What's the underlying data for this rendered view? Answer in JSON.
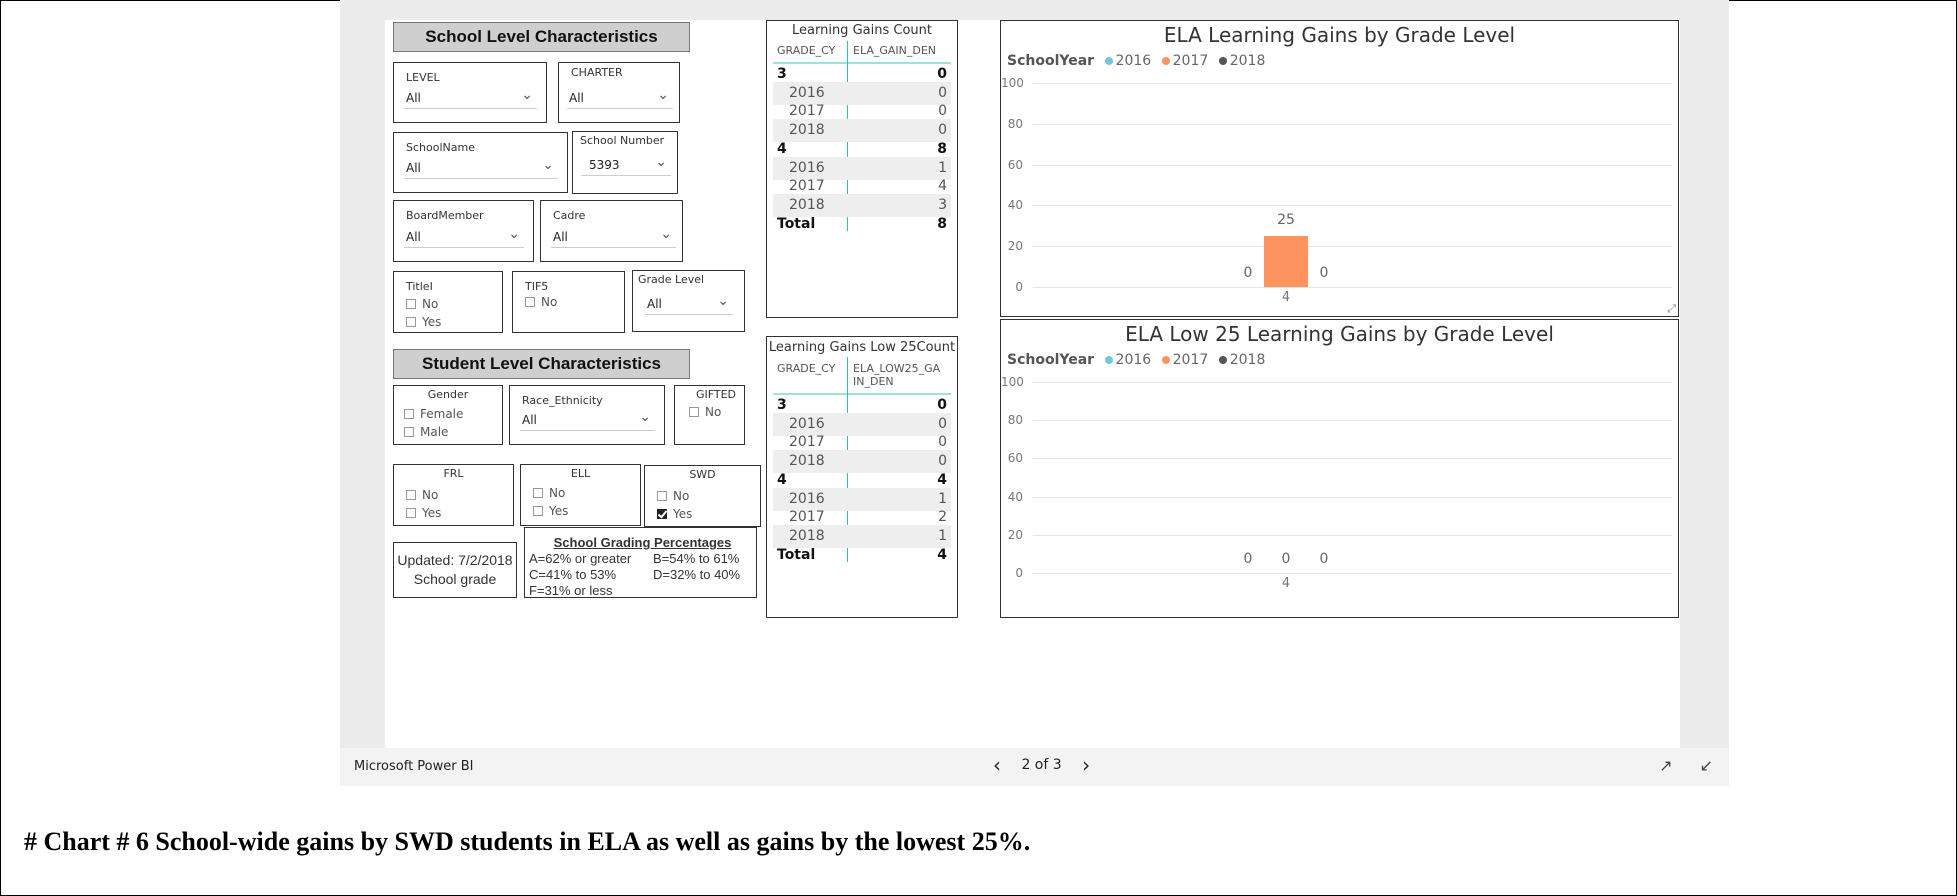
{
  "caption": "#  Chart # 6 School-wide gains by SWD students in ELA as well as gains by the lowest 25%.",
  "powerbi": {
    "brand": "Microsoft Power BI",
    "page": "2 of 3"
  },
  "school_title": "School Level Characteristics",
  "student_title": "Student Level Characteristics",
  "slicers": {
    "level": {
      "label": "LEVEL",
      "value": "All"
    },
    "charter": {
      "label": "CHARTER",
      "value": "All"
    },
    "school_name": {
      "label": "SchoolName",
      "value": "All"
    },
    "school_number": {
      "label": "School Number",
      "value": "5393"
    },
    "board_member": {
      "label": "BoardMember",
      "value": "All"
    },
    "cadre": {
      "label": "Cadre",
      "value": "All"
    },
    "titlei": {
      "label": "TitleI",
      "options": [
        "No",
        "Yes"
      ]
    },
    "tif5": {
      "label": "TIF5",
      "options": [
        "No"
      ]
    },
    "grade_level": {
      "label": "Grade Level",
      "value": "All"
    },
    "gender": {
      "label": "Gender",
      "options": [
        "Female",
        "Male"
      ]
    },
    "race": {
      "label": "Race_Ethnicity",
      "value": "All"
    },
    "gifted": {
      "label": "GIFTED",
      "options": [
        "No"
      ]
    },
    "frl": {
      "label": "FRL",
      "options": [
        "No",
        "Yes"
      ]
    },
    "ell": {
      "label": "ELL",
      "options": [
        "No",
        "Yes"
      ]
    },
    "swd": {
      "label": "SWD",
      "options": [
        "No",
        "Yes"
      ],
      "checked": "Yes"
    }
  },
  "updated": {
    "line1": "Updated: 7/2/2018",
    "line2": "School grade"
  },
  "grading": {
    "title": "School Grading Percentages",
    "rows": [
      [
        "A=62% or greater",
        "B=54% to 61%"
      ],
      [
        "C=41% to 53%",
        "D=32% to 40%"
      ],
      [
        "F=31% or less",
        ""
      ]
    ]
  },
  "matrix1": {
    "title": "Learning Gains Count",
    "col1": "GRADE_CY",
    "col2": "ELA_GAIN_DEN",
    "rows": [
      {
        "k": "3",
        "v": "0",
        "type": "grp"
      },
      {
        "k": "2016",
        "v": "0",
        "type": "yr"
      },
      {
        "k": "2017",
        "v": "0",
        "type": "yr"
      },
      {
        "k": "2018",
        "v": "0",
        "type": "yr"
      },
      {
        "k": "4",
        "v": "8",
        "type": "grp"
      },
      {
        "k": "2016",
        "v": "1",
        "type": "yr"
      },
      {
        "k": "2017",
        "v": "4",
        "type": "yr"
      },
      {
        "k": "2018",
        "v": "3",
        "type": "yr"
      },
      {
        "k": "Total",
        "v": "8",
        "type": "tot"
      }
    ]
  },
  "matrix2": {
    "title": "Learning Gains Low 25Count",
    "col1": "GRADE_CY",
    "col2a": "ELA_LOW25_GA",
    "col2b": "IN_DEN",
    "rows": [
      {
        "k": "3",
        "v": "0",
        "type": "grp"
      },
      {
        "k": "2016",
        "v": "0",
        "type": "yr"
      },
      {
        "k": "2017",
        "v": "0",
        "type": "yr"
      },
      {
        "k": "2018",
        "v": "0",
        "type": "yr"
      },
      {
        "k": "4",
        "v": "4",
        "type": "grp"
      },
      {
        "k": "2016",
        "v": "1",
        "type": "yr"
      },
      {
        "k": "2017",
        "v": "2",
        "type": "yr"
      },
      {
        "k": "2018",
        "v": "1",
        "type": "yr"
      },
      {
        "k": "Total",
        "v": "4",
        "type": "tot"
      }
    ]
  },
  "chart_data": [
    {
      "type": "bar",
      "title": "ELA Learning Gains by Grade Level",
      "legend_title": "SchoolYear",
      "legend_position": "top-left",
      "categories": [
        "4"
      ],
      "series": [
        {
          "name": "2016",
          "color": "#74c7dc",
          "values": [
            0
          ]
        },
        {
          "name": "2017",
          "color": "#fd9460",
          "values": [
            25
          ]
        },
        {
          "name": "2018",
          "color": "#555555",
          "values": [
            0
          ]
        }
      ],
      "ylim": [
        0,
        100
      ],
      "yticks": [
        "100",
        "80",
        "60",
        "40",
        "20",
        "0"
      ],
      "grid": true
    },
    {
      "type": "bar",
      "title": "ELA Low 25 Learning Gains by Grade Level",
      "legend_title": "SchoolYear",
      "legend_position": "top-left",
      "categories": [
        "4"
      ],
      "series": [
        {
          "name": "2016",
          "color": "#74c7dc",
          "values": [
            0
          ]
        },
        {
          "name": "2017",
          "color": "#fd9460",
          "values": [
            0
          ]
        },
        {
          "name": "2018",
          "color": "#555555",
          "values": [
            0
          ]
        }
      ],
      "ylim": [
        0,
        100
      ],
      "yticks": [
        "100",
        "80",
        "60",
        "40",
        "20",
        "0"
      ],
      "grid": true
    }
  ]
}
